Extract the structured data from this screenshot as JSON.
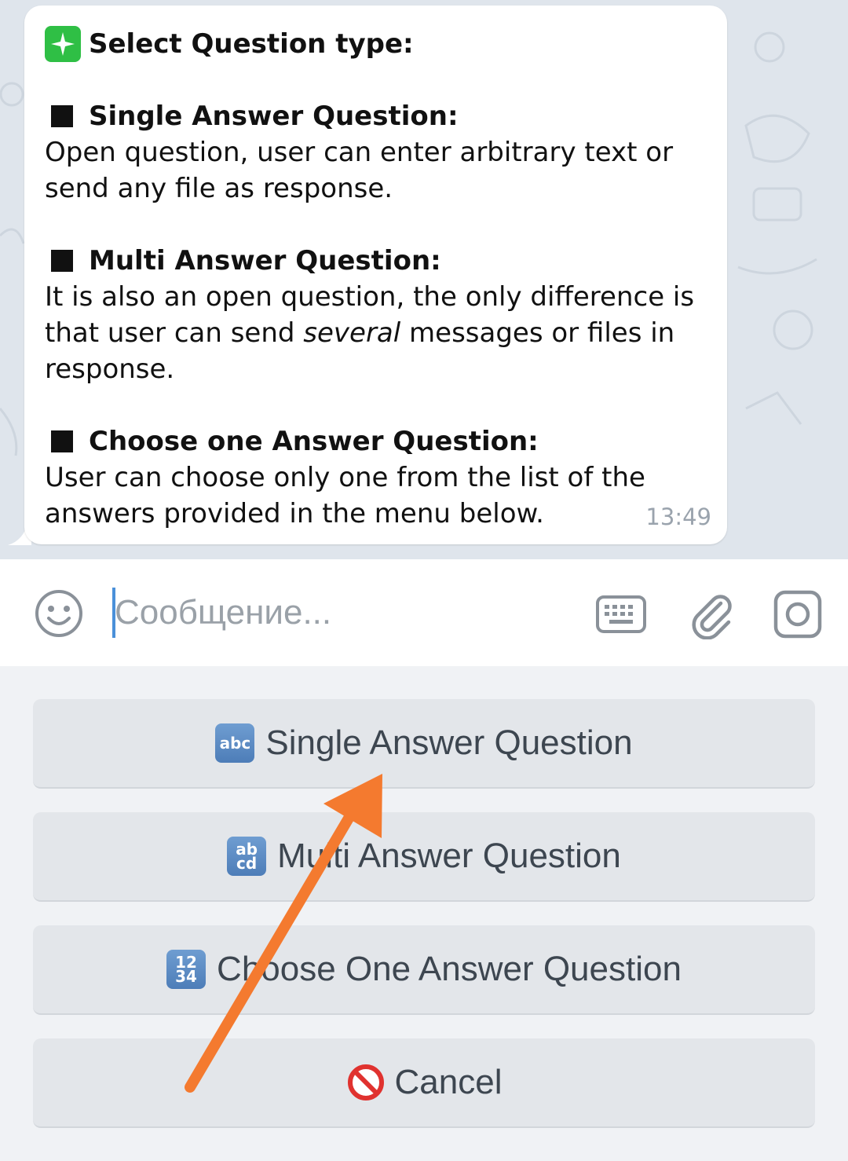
{
  "message": {
    "title": "Select Question type:",
    "sections": [
      {
        "heading": "Single Answer Question:",
        "lines": [
          "Open question, user can enter arbitrary text or",
          "send any file as response."
        ]
      },
      {
        "heading": "Multi Answer Question:",
        "line1": "It is also an open question, the only difference is",
        "line2_prefix": "that user can send ",
        "line2_emphasis": "several",
        "line2_suffix": " messages or files in",
        "line3": "response."
      },
      {
        "heading": "Choose one Answer Question:",
        "lines": [
          "User can choose only one from the list of the",
          "answers provided in the menu below."
        ]
      }
    ],
    "time": "13:49"
  },
  "input": {
    "placeholder": "Сообщение...",
    "icons": [
      "smile-icon",
      "keyboard-icon",
      "paperclip-icon",
      "camera-icon"
    ]
  },
  "keyboard": {
    "buttons": [
      {
        "emoji": "abc",
        "label": "Single Answer Question"
      },
      {
        "emoji": "ab cd",
        "label": "Multi Answer Question"
      },
      {
        "emoji": "12 34",
        "label": "Choose One Answer Question"
      },
      {
        "emoji": "no-entry",
        "label": "Cancel"
      }
    ]
  },
  "colors": {
    "accent": "#4a90d9",
    "annotation_arrow": "#f47a2f",
    "chat_background": "#dfe5ec"
  }
}
